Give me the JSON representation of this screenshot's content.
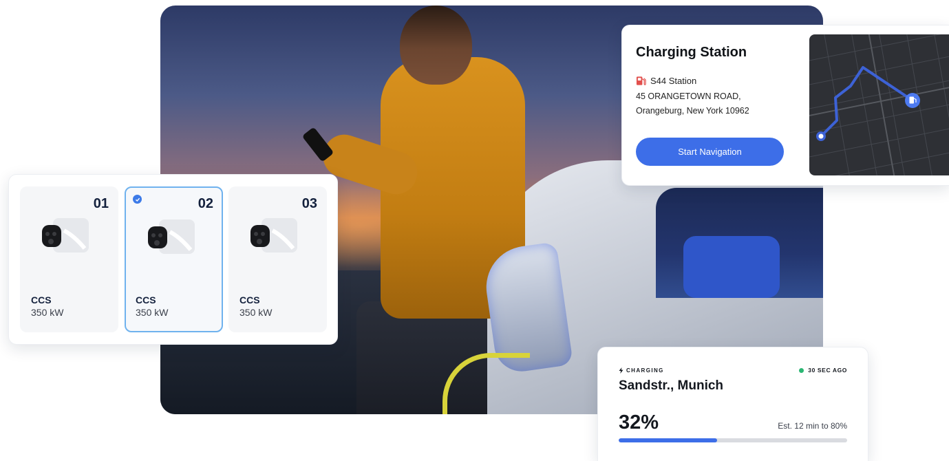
{
  "station_card": {
    "title": "Charging Station",
    "station_name": "S44 Station",
    "address_line1": "45 ORANGETOWN ROAD,",
    "address_line2": "Orangeburg, New York 10962",
    "navigate_label": "Start Navigation",
    "icon": "fuel-pump-icon"
  },
  "connectors": {
    "selected_index": 1,
    "items": [
      {
        "number": "01",
        "type": "CCS",
        "power": "350 kW"
      },
      {
        "number": "02",
        "type": "CCS",
        "power": "350 kW"
      },
      {
        "number": "03",
        "type": "CCS",
        "power": "350 kW"
      }
    ]
  },
  "status_card": {
    "state_label": "CHARGING",
    "updated": "30 SEC AGO",
    "location": "Sandstr., Munich",
    "percent_label": "32%",
    "progress": 0.43,
    "estimate": "Est. 12 min to 80%"
  },
  "colors": {
    "accent": "#3d6ee8",
    "selected_border": "#6fb2ee",
    "live_dot": "#2bb673",
    "fuel_icon": "#e2504d"
  }
}
